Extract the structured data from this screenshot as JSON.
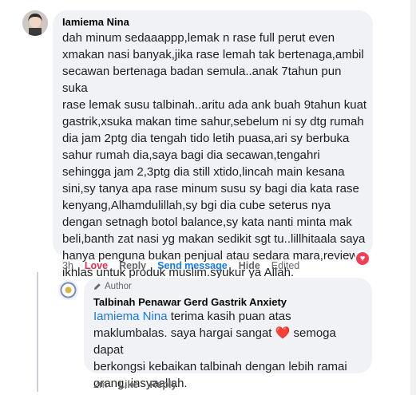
{
  "comment": {
    "author": "Iamiema Nina",
    "text": "dah minum sedaaappp,lemak n rase full perut even\nxmakan nasi banyak,jika rase lemah tak bertenaga,ambil\nsecawan bertenaga badan semula..anak 7tahun pun suka\nrase lemak susu talbinah..aritu ada ank buah 9tahun kuat\ngastrik,xsuka makan time sahur,sebelum ni sy dtg rumah\ndia jam 2ptg dia tengah tido letih puasa,ari sy berbuka\nsahur rumah dia,saya bagi dia secawan,tengahri\nsehingga jam 2,3ptg dia still xtido,lincah main kesana\nsini,sy tanya apa rase minum susu sy bagi dia kata rase\nkenyang,Alhamdulillah,sy bgi dia cube seterus nya\ndengan setnagh botol balance,sy kata nanti minta mak\nbeli,banth zat nasi yg makan sedikit sgt tu..lillhitaala saya\nhanya penguna bukan penjual atau sedara mara,review\nikhlas untuk produk muslim.syukur ya Allah.",
    "time": "3h",
    "love_label": "Love",
    "reply_label": "Reply",
    "send_label": "Send message",
    "hide_label": "Hide",
    "edited_label": "Edited"
  },
  "reply": {
    "author_badge": "Author",
    "author": "Talbinah Penawar Gerd Gastrik Anxiety",
    "mention": "Iamiema Nina",
    "text_line1_rest": " terima kasih puan atas",
    "text_line2": "maklumbalas. saya hargai sangat",
    "heart_emoji": "❤️",
    "text_line2_rest": " semoga dapat",
    "text_line3": "berkongsi kebaikan talbinah dengan lebih ramai",
    "text_line4": "orang, insyaallah.",
    "time": "2m",
    "like_label": "Like",
    "reply_label": "Reply"
  },
  "colors": {
    "bubble": "#f0f2f5",
    "love": "#f02849",
    "link": "#1877f2",
    "meta": "#65676b"
  }
}
